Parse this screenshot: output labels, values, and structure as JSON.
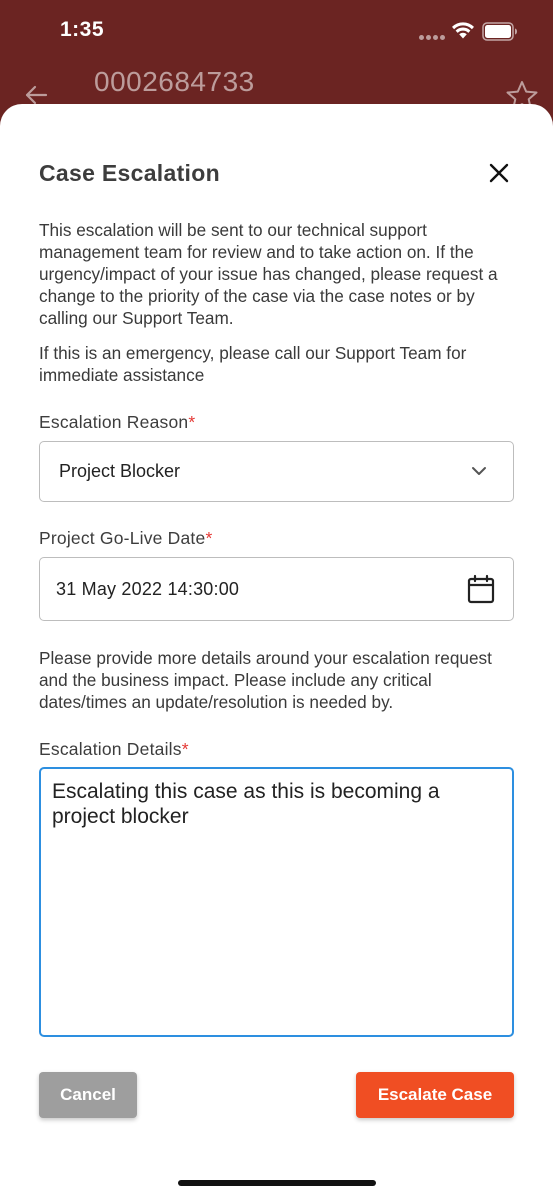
{
  "status_bar": {
    "time": "1:35"
  },
  "background": {
    "case_number": "0002684733",
    "icons": [
      "back-arrow-icon",
      "star-icon"
    ]
  },
  "modal": {
    "title": "Case Escalation",
    "close_icon": "close-icon",
    "intro_paragraph": "This escalation will be sent to our technical support management team for review and to take action on. If the urgency/impact of your issue has changed, please request a change to the priority of the case via the case notes or by calling our Support Team.",
    "emergency_paragraph": "If this is an emergency, please call our Support Team for immediate assistance",
    "escalation_reason": {
      "label": "Escalation Reason",
      "required_mark": "*",
      "value": "Project Blocker"
    },
    "go_live_date": {
      "label": "Project Go-Live Date",
      "required_mark": "*",
      "value": "31 May 2022 14:30:00"
    },
    "details_instructions": "Please provide more details around your escalation request and the business impact. Please include any critical dates/times an update/resolution is needed by.",
    "escalation_details": {
      "label": "Escalation Details",
      "required_mark": "*",
      "value": "Escalating this case as this is becoming a project blocker"
    },
    "cancel_label": "Cancel",
    "escalate_label": "Escalate Case"
  },
  "colors": {
    "header_background": "#6b2422",
    "primary_button": "#f04e23",
    "secondary_button": "#9e9e9e",
    "focus_border": "#2d8fe0",
    "required_mark": "#e53935"
  }
}
